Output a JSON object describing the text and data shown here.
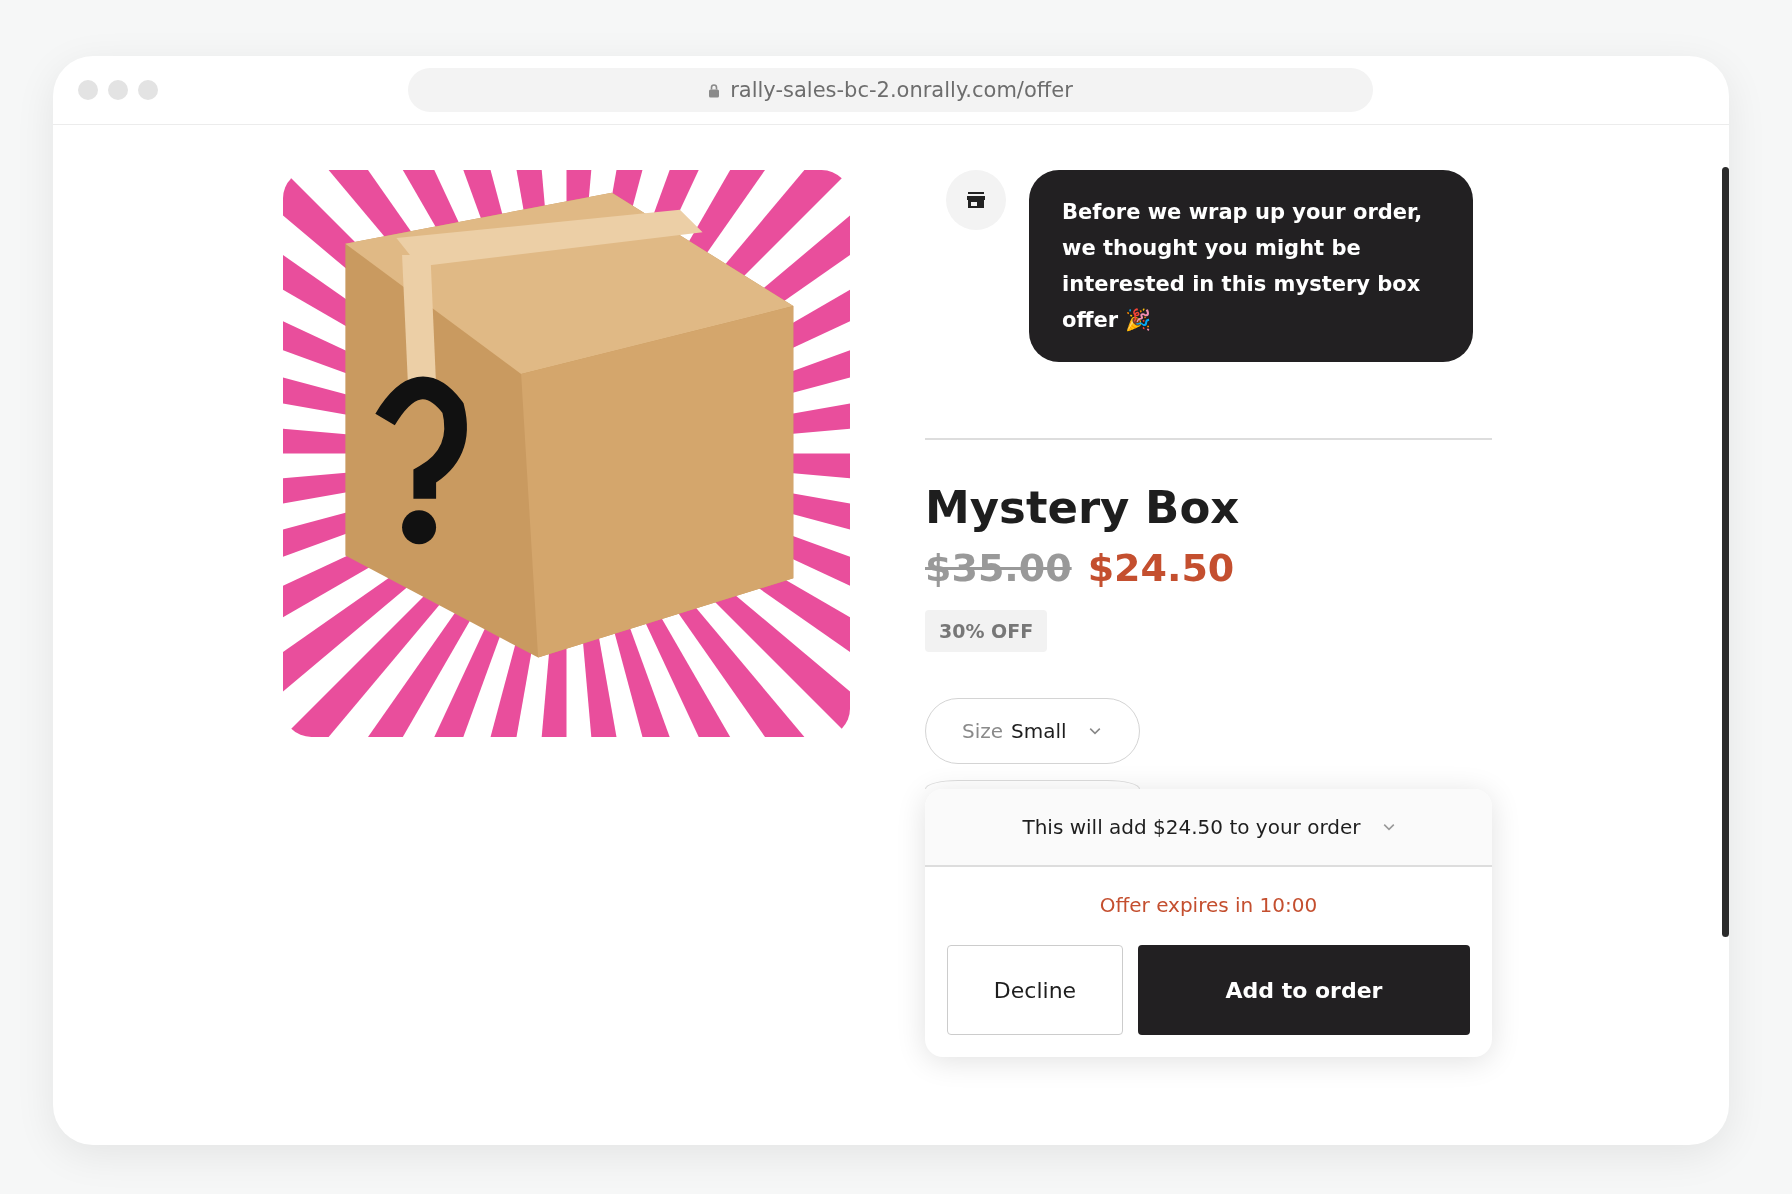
{
  "browser": {
    "url": "rally-sales-bc-2.onrally.com/offer"
  },
  "message": {
    "text": "Before we wrap up your order, we thought you might be interested in this mystery box offer 🎉"
  },
  "product": {
    "title": "Mystery Box",
    "original_price": "$35.00",
    "sale_price": "$24.50",
    "discount_badge": "30% OFF"
  },
  "size_select": {
    "label": "Size",
    "value": "Small"
  },
  "summary": {
    "text": "This will add $24.50 to your order",
    "expanded": false
  },
  "timer": "Offer expires in 10:00",
  "buttons": [
    {
      "label": "Decline",
      "kind": "secondary"
    },
    {
      "label": "Add to order",
      "kind": "primary"
    }
  ]
}
